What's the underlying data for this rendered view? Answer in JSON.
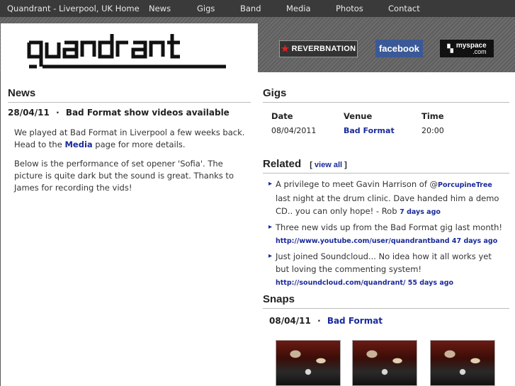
{
  "nav": {
    "home": "Quandrant - Liverpool, UK Home",
    "items": [
      "News",
      "Gigs",
      "Band",
      "Media",
      "Photos",
      "Contact"
    ]
  },
  "header": {
    "logo_text": "quandrant",
    "reverbnation": "REVERBNATION",
    "facebook": "facebook",
    "myspace_line1": "myspace",
    "myspace_line2": ".com"
  },
  "news": {
    "title": "News",
    "date": "28/04/11",
    "separator": "·",
    "headline": "Bad Format show videos available",
    "p1_before": "We played at Bad Format in Liverpool a few weeks back. Head to the ",
    "p1_link": "Media",
    "p1_after": " page for more details.",
    "p2": "Below is the performance of set opener 'Sofia'. The picture is quite dark but the sound is great. Thanks to James for recording the vids!"
  },
  "gigs": {
    "title": "Gigs",
    "headers": [
      "Date",
      "Venue",
      "Time"
    ],
    "rows": [
      {
        "date": "08/04/2011",
        "venue": "Bad Format",
        "time": "20:00"
      }
    ]
  },
  "related": {
    "title": "Related",
    "view_all_open": "[",
    "view_all": "view all",
    "view_all_close": "]",
    "items": [
      {
        "text_before": "A privilege to meet Gavin Harrison of @",
        "mention": "PorcupineTree",
        "text_after": " last night at the drum clinic. Dave handed him a demo CD.. you can only hope! - Rob ",
        "link": "",
        "ago": "7 days ago"
      },
      {
        "text_before": "Three new vids up from the Bad Format gig last month! ",
        "mention": "",
        "text_after": "",
        "link": "http://www.youtube.com/user/quandrantband",
        "ago": " 47 days ago"
      },
      {
        "text_before": "Just joined Soundcloud... No idea how it all works yet but loving the commenting system! ",
        "mention": "",
        "text_after": "",
        "link": "http://soundcloud.com/quandrant/",
        "ago": " 55 days ago"
      }
    ]
  },
  "snaps": {
    "title": "Snaps",
    "date": "08/04/11",
    "separator": "·",
    "venue": "Bad Format"
  }
}
